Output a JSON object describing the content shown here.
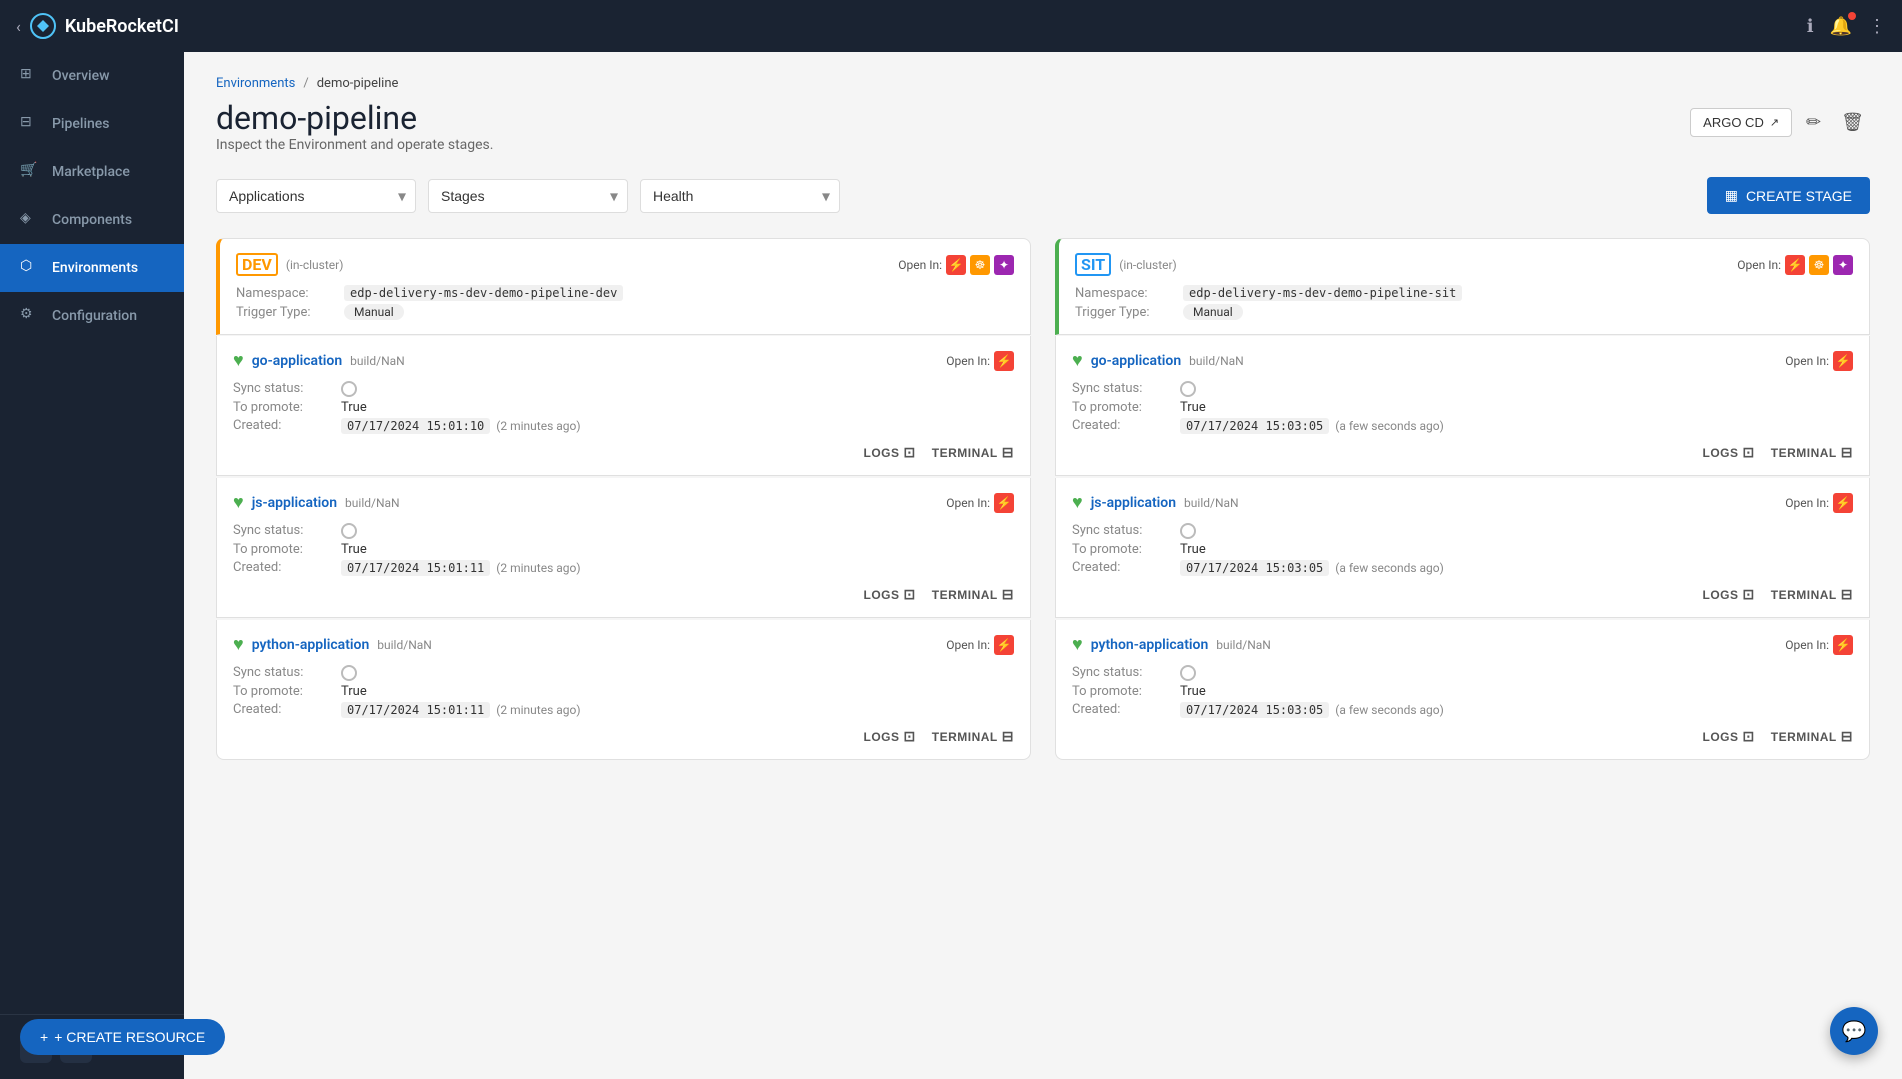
{
  "app": {
    "name": "KubeRocketCI"
  },
  "topnav": {
    "info_icon": "ℹ",
    "notification_icon": "🔔",
    "more_icon": "⋮",
    "collapse_icon": "‹"
  },
  "sidebar": {
    "items": [
      {
        "id": "overview",
        "label": "Overview",
        "icon": "⊞"
      },
      {
        "id": "pipelines",
        "label": "Pipelines",
        "icon": "⊟"
      },
      {
        "id": "marketplace",
        "label": "Marketplace",
        "icon": "🛒"
      },
      {
        "id": "components",
        "label": "Components",
        "icon": "◈"
      },
      {
        "id": "environments",
        "label": "Environments",
        "icon": "⬡",
        "active": true
      },
      {
        "id": "configuration",
        "label": "Configuration",
        "icon": "⚙"
      }
    ],
    "bottom": {
      "edit_icon": "✏",
      "settings_icon": "⚙"
    },
    "create_resource_label": "+ CREATE RESOURCE"
  },
  "breadcrumb": {
    "link_label": "Environments",
    "separator": "/",
    "current": "demo-pipeline"
  },
  "page": {
    "title": "demo-pipeline",
    "subtitle": "Inspect the Environment and operate stages.",
    "argo_cd_label": "ARGO CD",
    "edit_icon": "✏",
    "delete_icon": "🗑"
  },
  "filters": {
    "applications_label": "Applications",
    "applications_placeholder": "Applications",
    "stages_label": "Stages",
    "stages_placeholder": "Stages",
    "health_label": "Health",
    "health_placeholder": "Health"
  },
  "create_stage_btn": "CREATE STAGE",
  "stages": [
    {
      "id": "dev",
      "name": "DEV",
      "name_class": "dev",
      "cluster": "(in-cluster)",
      "open_in_label": "Open In:",
      "namespace_label": "Namespace:",
      "namespace": "edp-delivery-ms-dev-demo-pipeline-dev",
      "trigger_label": "Trigger Type:",
      "trigger": "Manual",
      "apps": [
        {
          "id": "go-app-dev",
          "name": "go-application",
          "build": "build/NaN",
          "open_in_label": "Open In:",
          "sync_status_label": "Sync status:",
          "to_promote_label": "To promote:",
          "to_promote_value": "True",
          "created_label": "Created:",
          "created_timestamp": "07/17/2024 15:01:10",
          "created_ago": "(2 minutes ago)",
          "logs_label": "LOGS",
          "terminal_label": "TERMINAL"
        },
        {
          "id": "js-app-dev",
          "name": "js-application",
          "build": "build/NaN",
          "open_in_label": "Open In:",
          "sync_status_label": "Sync status:",
          "to_promote_label": "To promote:",
          "to_promote_value": "True",
          "created_label": "Created:",
          "created_timestamp": "07/17/2024 15:01:11",
          "created_ago": "(2 minutes ago)",
          "logs_label": "LOGS",
          "terminal_label": "TERMINAL"
        },
        {
          "id": "python-app-dev",
          "name": "python-application",
          "build": "build/NaN",
          "open_in_label": "Open In:",
          "sync_status_label": "Sync status:",
          "to_promote_label": "To promote:",
          "to_promote_value": "True",
          "created_label": "Created:",
          "created_timestamp": "07/17/2024 15:01:11",
          "created_ago": "(2 minutes ago)",
          "logs_label": "LOGS",
          "terminal_label": "TERMINAL"
        }
      ]
    },
    {
      "id": "sit",
      "name": "SIT",
      "name_class": "sit",
      "cluster": "(in-cluster)",
      "open_in_label": "Open In:",
      "namespace_label": "Namespace:",
      "namespace": "edp-delivery-ms-dev-demo-pipeline-sit",
      "trigger_label": "Trigger Type:",
      "trigger": "Manual",
      "apps": [
        {
          "id": "go-app-sit",
          "name": "go-application",
          "build": "build/NaN",
          "open_in_label": "Open In:",
          "sync_status_label": "Sync status:",
          "to_promote_label": "To promote:",
          "to_promote_value": "True",
          "created_label": "Created:",
          "created_timestamp": "07/17/2024 15:03:05",
          "created_ago": "(a few seconds ago)",
          "logs_label": "LOGS",
          "terminal_label": "TERMINAL"
        },
        {
          "id": "js-app-sit",
          "name": "js-application",
          "build": "build/NaN",
          "open_in_label": "Open In:",
          "sync_status_label": "Sync status:",
          "to_promote_label": "To promote:",
          "to_promote_value": "True",
          "created_label": "Created:",
          "created_timestamp": "07/17/2024 15:03:05",
          "created_ago": "(a few seconds ago)",
          "logs_label": "LOGS",
          "terminal_label": "TERMINAL"
        },
        {
          "id": "python-app-sit",
          "name": "python-application",
          "build": "build/NaN",
          "open_in_label": "Open In:",
          "sync_status_label": "Sync status:",
          "to_promote_label": "To promote:",
          "to_promote_value": "True",
          "created_label": "Created:",
          "created_timestamp": "07/17/2024 15:03:05",
          "created_ago": "(a few seconds ago)",
          "logs_label": "LOGS",
          "terminal_label": "TERMINAL"
        }
      ]
    }
  ]
}
